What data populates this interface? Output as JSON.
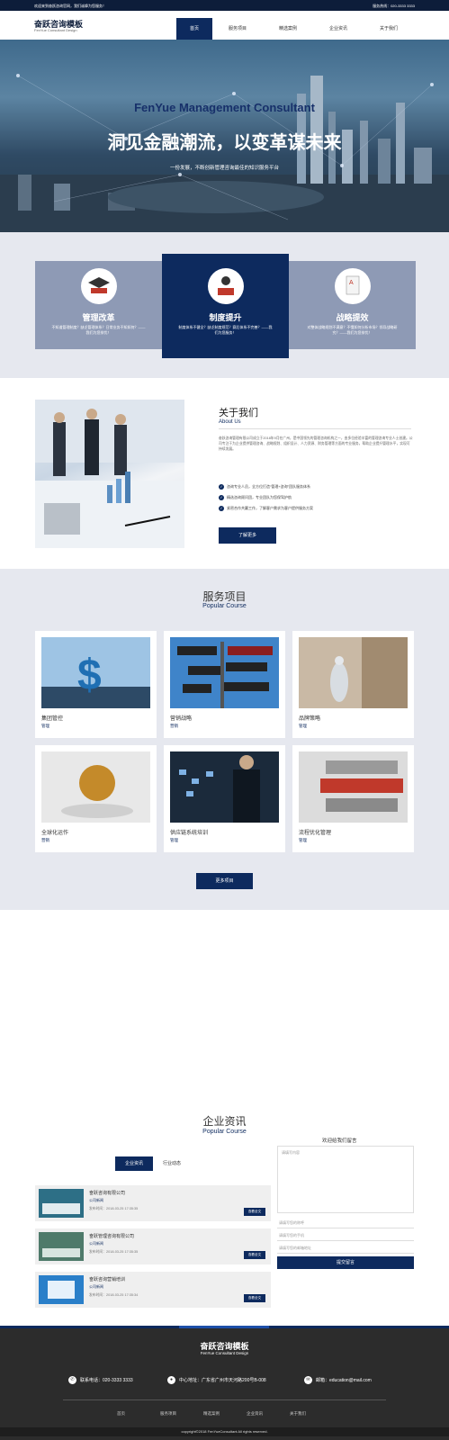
{
  "topbar": {
    "left": "欢迎来到奋跃咨询官网，我们诚挚为您服务！",
    "right": "服务热线：020-3333 3333"
  },
  "header": {
    "logo_cn": "奋跃咨询模板",
    "logo_en": "FenYue Consultant Design"
  },
  "nav": [
    {
      "label": "首页"
    },
    {
      "label": "服务项目"
    },
    {
      "label": "精选案例"
    },
    {
      "label": "企业资讯"
    },
    {
      "label": "关于我们"
    }
  ],
  "hero": {
    "en": "FenYue Management Consultant",
    "cn": "洞见金融潮流，以变革谋未来",
    "sub": "一份发展，不断创新管理咨询最佳的知识服务平台"
  },
  "features": [
    {
      "title": "管理改革",
      "desc": "不知道管理制度？缺乏管理体系？日常业务不知如何？——我们为您排忧！"
    },
    {
      "title": "制度提升",
      "desc": "制度体系不健全？缺乏制度规范？赛后体系不完善？——我们为您服务！"
    },
    {
      "title": "战略提效",
      "desc": "对整体战略规划不满意？不懂如何分析市场？领导战略研究？——我们为您排忧！"
    }
  ],
  "about": {
    "title": "关于我们",
    "subtitle": "About Us",
    "text": "奋跃咨询管理有限公司成立于2018年9月在广州，是中国领先的管理咨询机构之一，由多位经验丰富的管理咨询专业人士创建。公司专注于为企业提供管理咨询、战略规划、组织设计、人力资源、财务管理等方面的专业服务，帮助企业提升管理水平，实现可持续发展。",
    "bullets": [
      "咨询专业人员，全方位打造“管理+咨询”团队服务体系",
      "精选咨询顾问团，专业团队为您保驾护航",
      "紧密合作共赢工作，了解客户需求为客户提供服务方案"
    ],
    "button": "了解更多"
  },
  "services": {
    "title": "服务项目",
    "subtitle": "Popular Course",
    "items": [
      {
        "name": "集团管控",
        "tag": "管理"
      },
      {
        "name": "营销战略",
        "tag": "营销"
      },
      {
        "name": "品牌策略",
        "tag": "管理"
      },
      {
        "name": "全球化运作",
        "tag": "营销"
      },
      {
        "name": "供应链系统培训",
        "tag": "管理"
      },
      {
        "name": "流程优化管理",
        "tag": "管理"
      }
    ],
    "button": "更多项目"
  },
  "news": {
    "title": "企业资讯",
    "subtitle": "Popular Course",
    "tabs": [
      {
        "label": "企业资讯"
      },
      {
        "label": "行业动态"
      }
    ],
    "items": [
      {
        "title": "奋跃咨询有限公司",
        "company": "公司新闻",
        "date": "发布时间：2018-03-25 17:35:35",
        "button": "查看全文"
      },
      {
        "title": "奋跃管理咨询有限公司",
        "company": "公司新闻",
        "date": "发布时间：2018-03-25 17:35:35",
        "button": "查看全文"
      },
      {
        "title": "奋跃咨询营销培训",
        "company": "公司新闻",
        "date": "发布时间：2018-03-25 17:35:34",
        "button": "查看全文"
      }
    ],
    "form_title": "欢迎给我们留言",
    "form": {
      "message_placeholder": "请填写内容",
      "name_placeholder": "请填写您的称呼",
      "phone_placeholder": "请填写您的手机",
      "email_placeholder": "请填写您的邮箱地址",
      "submit": "提交留言"
    }
  },
  "footer": {
    "logo_cn": "奋跃咨询模板",
    "logo_en": "FenYue Consultant Design",
    "phone": "联系电话：020-3333 3333",
    "address": "中心地址：广东省广州市天河路200号B-008",
    "email": "邮箱：education@mail.com",
    "nav": [
      "首页",
      "服务项目",
      "精选案例",
      "企业资讯",
      "关于我们"
    ],
    "copyright": "copyright©2018 FenYueConsultant All rights reserved."
  }
}
